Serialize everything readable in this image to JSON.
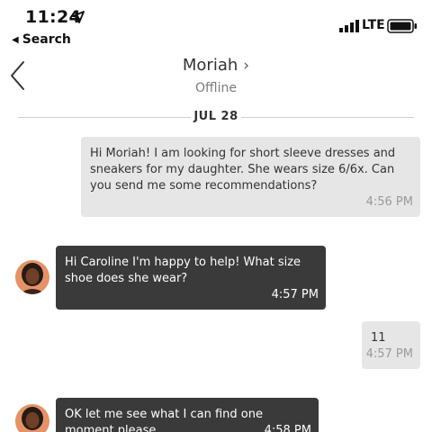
{
  "status_bar": {
    "time": "11:24",
    "back_app_label": "Search",
    "network": "LTE"
  },
  "header": {
    "contact_name": "Moriah",
    "presence": "Offline"
  },
  "thread": {
    "date_label": "JUL 28",
    "messages": [
      {
        "direction": "outgoing",
        "text": "Hi Moriah! I am looking for short sleeve dresses and sneakers for my daughter. She wears size 6/6x. Can you send me some recommendations?",
        "time": "4:56 PM"
      },
      {
        "direction": "incoming",
        "text": "Hi Caroline I'm happy to help! What size shoe does she wear?",
        "time": "4:57 PM"
      },
      {
        "direction": "outgoing",
        "text": "11",
        "time": "4:57 PM"
      },
      {
        "direction": "incoming",
        "text": "OK let me see what I can find one moment please",
        "time": "4:58 PM"
      }
    ]
  },
  "colors": {
    "outgoing_bubble": "#e6e6e6",
    "incoming_bubble": "#3a3a3a",
    "divider": "#cfcfcf"
  },
  "icons": [
    "location-arrow-icon",
    "back-triangle-icon",
    "signal-bars-icon",
    "battery-icon",
    "back-chevron-icon",
    "chevron-right-icon",
    "avatar"
  ]
}
